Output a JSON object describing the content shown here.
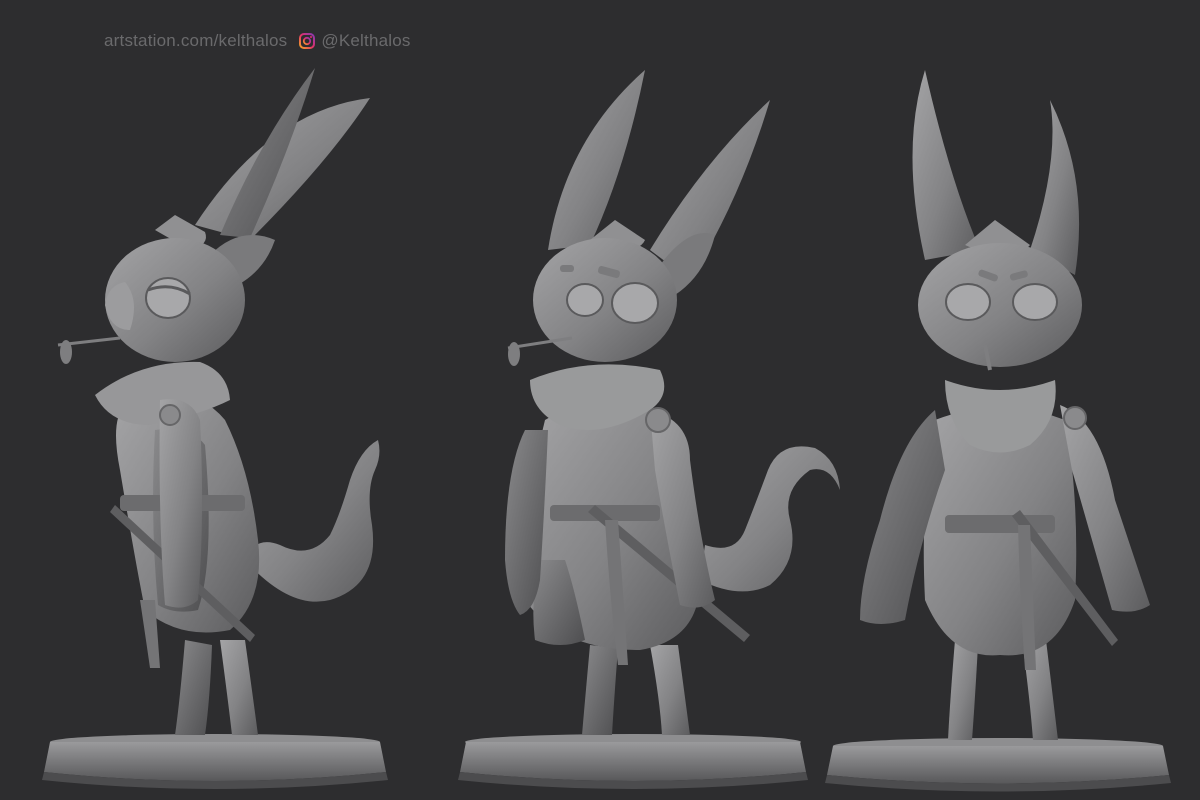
{
  "watermark": {
    "site_text": "artstation.com/kelthalos",
    "instagram_handle": "@Kelthalos",
    "instagram_icon": "instagram-icon"
  },
  "render": {
    "background_color": "#2d2d2f",
    "clay_color": "#8c8c8e",
    "text_color": "#6a6a6c",
    "views": [
      "side-view",
      "three-quarter-view",
      "front-view"
    ]
  }
}
